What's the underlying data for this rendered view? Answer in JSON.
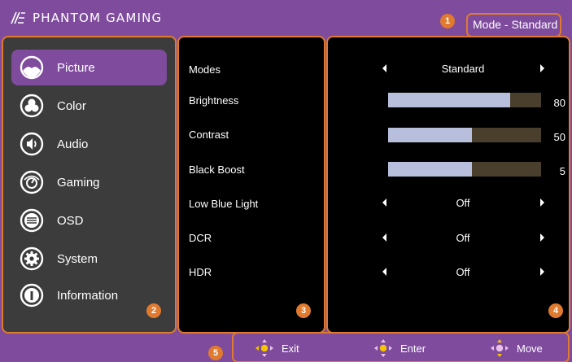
{
  "header": {
    "brand": "PHANTOM GAMING",
    "mode_label": "Mode - Standard"
  },
  "markers": [
    "1",
    "2",
    "3",
    "4",
    "5"
  ],
  "sidebar": {
    "items": [
      {
        "label": "Picture",
        "icon": "picture-icon",
        "active": true
      },
      {
        "label": "Color",
        "icon": "color-icon"
      },
      {
        "label": "Audio",
        "icon": "audio-icon"
      },
      {
        "label": "Gaming",
        "icon": "gaming-icon"
      },
      {
        "label": "OSD",
        "icon": "osd-icon"
      },
      {
        "label": "System",
        "icon": "system-icon"
      },
      {
        "label": "Information",
        "icon": "information-icon"
      }
    ]
  },
  "settings": [
    {
      "label": "Modes",
      "type": "option",
      "value": "Standard"
    },
    {
      "label": "Brightness",
      "type": "slider",
      "value": "80",
      "fraction": 0.8
    },
    {
      "label": "Contrast",
      "type": "slider",
      "value": "50",
      "fraction": 0.55
    },
    {
      "label": "Black Boost",
      "type": "slider",
      "value": "5",
      "fraction": 0.55
    },
    {
      "label": "Low Blue Light",
      "type": "option",
      "value": "Off"
    },
    {
      "label": "DCR",
      "type": "option",
      "value": "Off"
    },
    {
      "label": "HDR",
      "type": "option",
      "value": "Off"
    }
  ],
  "footer": {
    "exit_label": "Exit",
    "enter_label": "Enter",
    "move_label": "Move"
  },
  "colors": {
    "brand_purple": "#7e4b9d",
    "accent_orange": "#e07a2f",
    "slider_fill": "#b8bfdc",
    "slider_track": "#4a3f2c",
    "joystick_yellow": "#f5c400"
  }
}
